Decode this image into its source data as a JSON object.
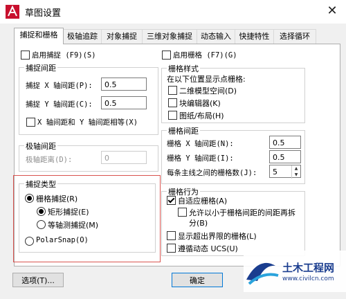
{
  "window": {
    "title": "草图设置",
    "close_glyph": "✕",
    "app_icon": "autocad-app-icon"
  },
  "tabs": [
    "捕捉和栅格",
    "极轴追踪",
    "对象捕捉",
    "三维对象捕捉",
    "动态输入",
    "快捷特性",
    "选择循环"
  ],
  "snap": {
    "enable_label": "启用捕捉 (F9)(S)",
    "enabled": false,
    "spacing_group": "捕捉间距",
    "x_label": "捕捉 X 轴间距(P):",
    "x_value": "0.5",
    "y_label": "捕捉 Y 轴间距(C):",
    "y_value": "0.5",
    "equal_label": "X 轴间距和 Y 轴间距相等(X)",
    "equal_checked": false
  },
  "polar": {
    "group": "极轴间距",
    "distance_label": "极轴距离(D):",
    "distance_value": "0"
  },
  "snap_type": {
    "group": "捕捉类型",
    "grid_snap": "栅格捕捉(R)",
    "rect_snap": "矩形捕捉(E)",
    "iso_snap": "等轴测捕捉(M)",
    "polar_snap": "PolarSnap(O)",
    "selected": "grid_snap",
    "sub_selected": "rect_snap"
  },
  "grid": {
    "enable_label": "启用栅格 (F7)(G)",
    "enabled": false,
    "style_group": "栅格样式",
    "style_hint": "在以下位置显示点栅格:",
    "style_options": [
      "二维模型空间(D)",
      "块编辑器(K)",
      "图纸/布局(H)"
    ],
    "spacing_group": "栅格间距",
    "x_label": "栅格 X 轴间距(N):",
    "x_value": "0.5",
    "y_label": "栅格 Y 轴间距(I):",
    "y_value": "0.5",
    "major_label": "每条主线之间的栅格数(J):",
    "major_value": "5"
  },
  "behavior": {
    "group": "栅格行为",
    "adaptive": "自适应栅格(A)",
    "adaptive_checked": true,
    "subdivide_line1": "允许以小于栅格间距的间距再拆",
    "subdivide_line2": "分(B)",
    "subdivide_checked": false,
    "beyond_limits": "显示超出界限的栅格(L)",
    "beyond_checked": false,
    "follow_ucs": "遵循动态 UCS(U)",
    "follow_checked": false
  },
  "buttons": {
    "options": "选项(T)...",
    "ok": "确定"
  },
  "watermark": {
    "title": "土木工程网",
    "url": "www.civilcn.com"
  },
  "colors": {
    "accent": "#0078d7",
    "highlight": "#d9534f"
  }
}
